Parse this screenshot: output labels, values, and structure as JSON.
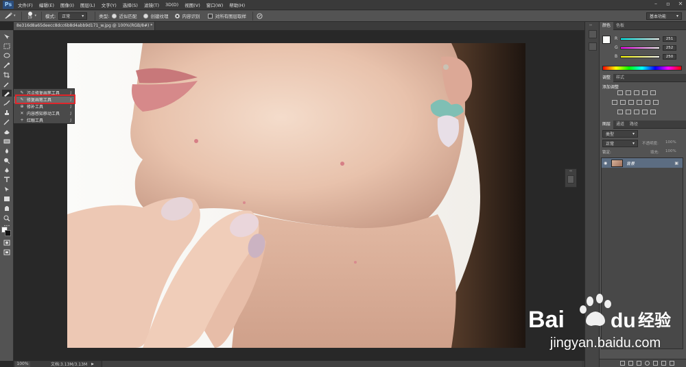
{
  "app": {
    "logo": "Ps",
    "menu": [
      "文件(F)",
      "编辑(E)",
      "图像(I)",
      "图层(L)",
      "文字(Y)",
      "选择(S)",
      "滤镜(T)",
      "3D(D)",
      "视图(V)",
      "窗口(W)",
      "帮助(H)"
    ]
  },
  "options": {
    "brush_size": "19",
    "mode_label": "模式:",
    "mode_value": "正常",
    "type_label": "类型:",
    "radio_proximity": "近似匹配",
    "radio_texture": "创建纹理",
    "radio_content": "内容识别",
    "sample_all": "对所有图层取样",
    "workspace": "基本功能"
  },
  "document": {
    "tab_title": "8e316d8a65deecc8dcc6b8d4abb9d171_w.jpg @ 100%(RGB/8#) *",
    "zoom": "100%",
    "doc_size": "文档:3.13M/3.13M"
  },
  "flyout": {
    "items": [
      {
        "label": "污点修复画笔工具",
        "key": "J",
        "icon": "spot-healing-brush-icon"
      },
      {
        "label": "修复画笔工具",
        "key": "J",
        "icon": "healing-brush-icon"
      },
      {
        "label": "修补工具",
        "key": "J",
        "icon": "patch-icon"
      },
      {
        "label": "内容感知移动工具",
        "key": "J",
        "icon": "content-aware-move-icon"
      },
      {
        "label": "红眼工具",
        "key": "J",
        "icon": "red-eye-icon"
      }
    ],
    "selected_index": 1,
    "highlight_color": "#e0262b"
  },
  "color_panel": {
    "tabs": [
      "颜色",
      "色板"
    ],
    "r": "251",
    "g": "252",
    "b": "250",
    "r_label": "R",
    "g_label": "G",
    "b_label": "B"
  },
  "adjust_panel": {
    "tabs": [
      "调整",
      "样式"
    ],
    "title": "添加调整"
  },
  "layers_panel": {
    "tabs": [
      "图层",
      "通道",
      "路径"
    ],
    "kind_label": "类型",
    "blend_mode": "正常",
    "opacity_label": "不透明度:",
    "opacity": "100%",
    "lock_label": "锁定:",
    "fill_label": "填充:",
    "fill": "100%",
    "layer_name": "背景"
  },
  "watermark": {
    "brand": "Bai",
    "brand2": "du",
    "cn": "经验",
    "url": "jingyan.baidu.com"
  },
  "colors": {
    "ui_dark": "#282828",
    "ui_panel": "#535353",
    "accent_red": "#e0262b"
  }
}
